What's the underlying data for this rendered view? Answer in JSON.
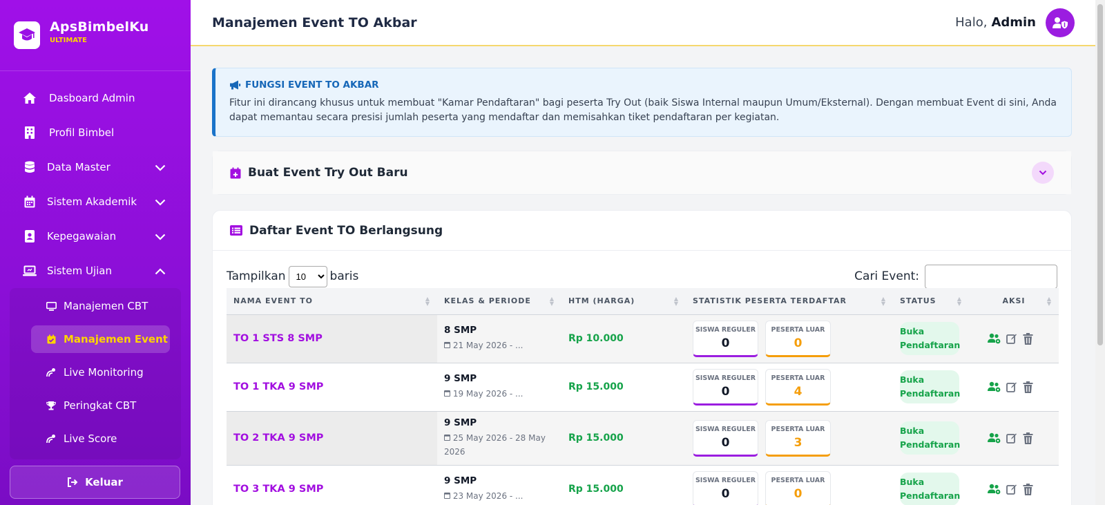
{
  "brand": {
    "name": "ApsBimbelKu",
    "sub": "ULTIMATE"
  },
  "sidebar": {
    "items": [
      {
        "label": "Dasboard Admin"
      },
      {
        "label": "Profil Bimbel"
      },
      {
        "label": "Data Master"
      },
      {
        "label": "Sistem Akademik"
      },
      {
        "label": "Kepegawaian"
      },
      {
        "label": "Sistem Ujian"
      }
    ],
    "subitems": [
      {
        "label": "Manajemen CBT"
      },
      {
        "label": "Manajemen Event"
      },
      {
        "label": "Live Monitoring"
      },
      {
        "label": "Peringkat CBT"
      },
      {
        "label": "Live Score"
      }
    ],
    "logout": "Keluar"
  },
  "header": {
    "title": "Manajemen Event TO Akbar",
    "greeting": "Halo,",
    "user": "Admin"
  },
  "info": {
    "title": "FUNGSI EVENT TO AKBAR",
    "text": "Fitur ini dirancang khusus untuk membuat \"Kamar Pendaftaran\" bagi peserta Try Out (baik Siswa Internal maupun Umum/Eksternal). Dengan membuat Event di sini, Anda dapat memantau secara presisi jumlah peserta yang mendaftar dan memisahkan tiket pendaftaran per kegiatan."
  },
  "create_panel": {
    "title": "Buat Event Try Out Baru"
  },
  "list": {
    "title": "Daftar Event TO Berlangsung",
    "show_label": "Tampilkan",
    "rows_label": "baris",
    "page_size": "10",
    "search_label": "Cari Event:",
    "columns": [
      "NAMA EVENT TO",
      "KELAS & PERIODE",
      "HTM (HARGA)",
      "STATISTIK PESERTA TERDAFTAR",
      "STATUS",
      "AKSI"
    ],
    "stat_labels": {
      "reg": "SISWA REGULER",
      "luar": "PESERTA LUAR"
    },
    "rows": [
      {
        "name": "TO 1 STS 8 SMP",
        "kelas": "8 SMP",
        "periode": "21 May 2026 - ...",
        "harga": "Rp 10.000",
        "reg": "0",
        "luar": "0",
        "status": "Buka Pendaftaran"
      },
      {
        "name": "TO 1 TKA 9 SMP",
        "kelas": "9 SMP",
        "periode": "19 May 2026 - ...",
        "harga": "Rp 15.000",
        "reg": "0",
        "luar": "4",
        "status": "Buka Pendaftaran"
      },
      {
        "name": "TO 2 TKA 9 SMP",
        "kelas": "9 SMP",
        "periode": "25 May 2026 - 28 May 2026",
        "harga": "Rp 15.000",
        "reg": "0",
        "luar": "3",
        "status": "Buka Pendaftaran"
      },
      {
        "name": "TO 3 TKA 9 SMP",
        "kelas": "9 SMP",
        "periode": "23 May 2026 - ...",
        "harga": "Rp 15.000",
        "reg": "0",
        "luar": "0",
        "status": "Buka Pendaftaran"
      }
    ]
  },
  "colors": {
    "sidebar": "#9b10e6",
    "accent": "#a20fe0",
    "highlight": "#ffd400",
    "success": "#16a34a",
    "warning": "#f59e0b",
    "info": "#1a73c9"
  },
  "icons": [
    "graduation-cap-icon",
    "home-icon",
    "building-icon",
    "database-icon",
    "calendar-icon",
    "badge-icon",
    "laptop-icon",
    "monitor-icon",
    "calendar-check-icon",
    "satellite-icon",
    "trophy-icon",
    "logout-icon",
    "user-shield-icon",
    "bullhorn-icon",
    "calendar-plus-icon",
    "list-icon",
    "users-cog-icon",
    "edit-icon",
    "trash-icon"
  ]
}
